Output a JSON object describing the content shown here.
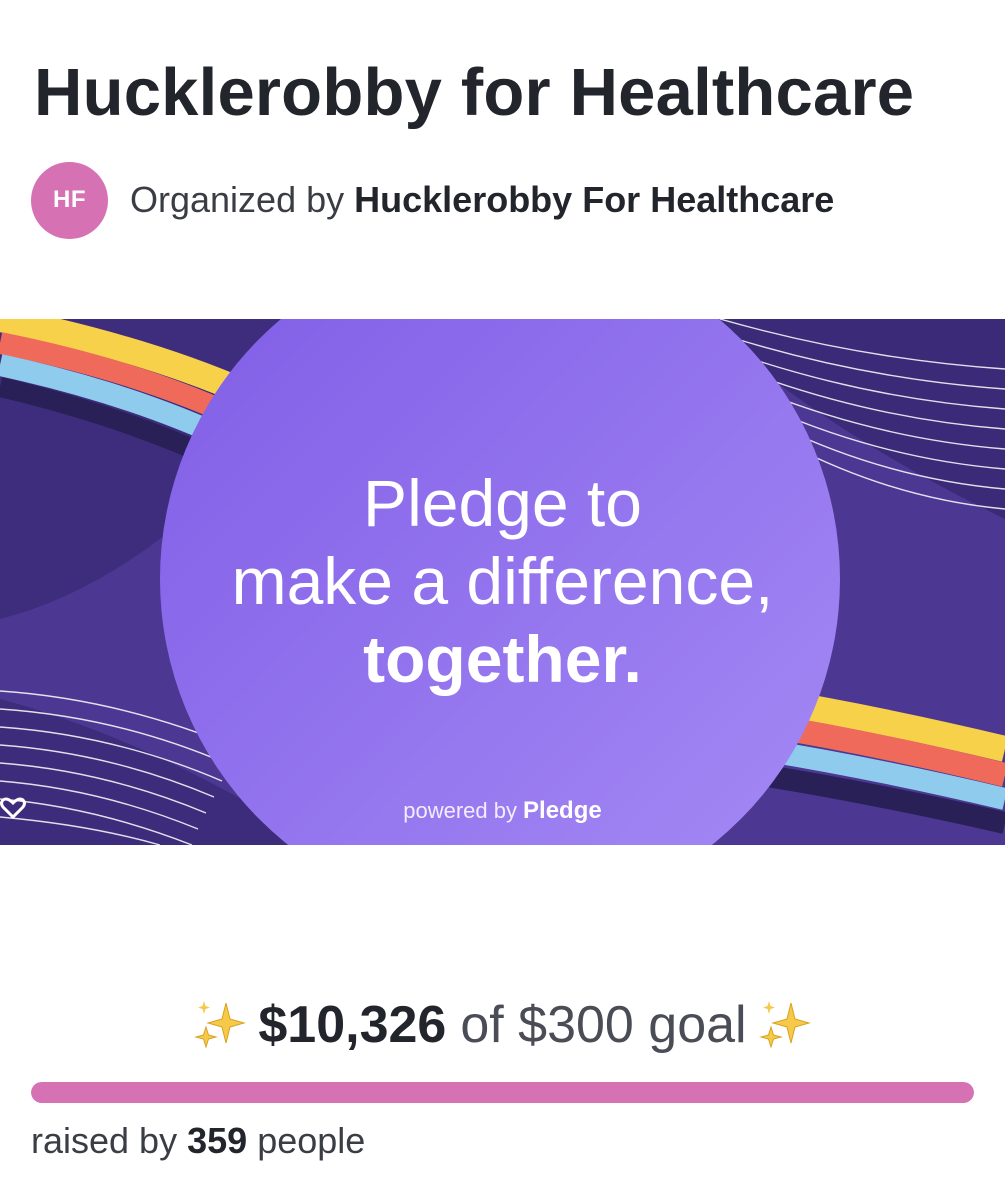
{
  "campaign": {
    "title": "Hucklerobby for Healthcare"
  },
  "organizer": {
    "avatar_initials": "HF",
    "prefix": "Organized by",
    "name": "Hucklerobby For Healthcare",
    "avatar_color": "#d672b4"
  },
  "banner": {
    "line1": "Pledge to",
    "line2": "make a difference,",
    "line3": "together.",
    "powered_by": "powered by",
    "brand": "Pledge",
    "colors": {
      "background": "#4c3893",
      "circle": "#8b67ec",
      "stripe_yellow": "#f8d14a",
      "stripe_red": "#ef6a5b",
      "stripe_blue": "#8fcbec",
      "stripe_dark": "#2a2058"
    }
  },
  "fundraising": {
    "raised": "$10,326",
    "goal_text": "of $300 goal",
    "raised_by_prefix": "raised by",
    "people_count": "359",
    "raised_by_suffix": "people",
    "progress_fraction": 1.0,
    "sparkle_icon": "sparkles-icon",
    "progress_color": "#d672b4"
  }
}
